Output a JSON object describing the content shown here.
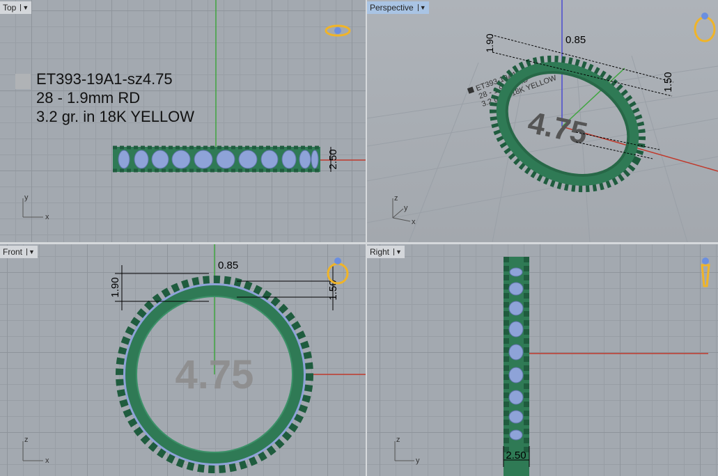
{
  "viewports": {
    "top": {
      "label": "Top",
      "axes": {
        "a": "y",
        "b": "x"
      }
    },
    "perspective": {
      "label": "Perspective",
      "axes": {
        "a": "z",
        "b": "y",
        "c": "x"
      }
    },
    "front": {
      "label": "Front",
      "axes": {
        "a": "z",
        "b": "x"
      }
    },
    "right": {
      "label": "Right",
      "axes": {
        "a": "z",
        "b": "y"
      }
    }
  },
  "annotation": {
    "line1": "ET393-19A1-sz4.75",
    "line2": "28 - 1.9mm RD",
    "line3": "3.2 gr.  in 18K YELLOW"
  },
  "size_label": "4.75",
  "dimensions": {
    "width": "2.50",
    "stone": "1.90",
    "gap": "0.85",
    "height": "1.50"
  },
  "colors": {
    "metal": "#2f7a55",
    "stone": "#8ea3d8",
    "grid": "#a3a9b0",
    "x_axis": "#c0392b",
    "y_axis": "#3fa53f",
    "z_axis": "#4a4ad0",
    "ring_icon": "#f0b428"
  }
}
